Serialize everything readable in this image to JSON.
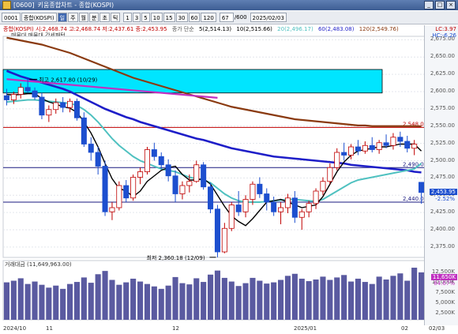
{
  "window": {
    "code": "[0600]",
    "title": "키움종합차트 - 종합(KOSPI)"
  },
  "toolbar": {
    "index_code": "0001",
    "index_name": "종합(KOSPI)",
    "period_buttons": [
      "일",
      "주",
      "월",
      "분",
      "초",
      "틱"
    ],
    "selected_period": "일",
    "interval_buttons": [
      "1",
      "3",
      "5",
      "10",
      "15",
      "30",
      "60",
      "120"
    ],
    "count": "67",
    "total": "/600",
    "date": "2025/02/03"
  },
  "legend": {
    "price_line": "종합(KOSPI) 시:2,468.74 고:2,468.74 저:2,437.61 종:2,453.95",
    "ma_label": "종가 단순",
    "ma5": "5(2,514.13)",
    "ma10": "10(2,515.66)",
    "ma20": "20(2,496.17)",
    "ma60": "60(2,483.08)",
    "ma120": "120(2,549.76)",
    "sub_label": "매물대 매물대 강세패턴",
    "lc": "LC:3.97",
    "hc": "HC:-6.26"
  },
  "annotations": {
    "high": "최고 2,617.80 (10/29)",
    "low": "최저 2,360.18 (12/09)"
  },
  "hlines": [
    {
      "value": 2548.08,
      "label": "2,548.08",
      "color": "#c00000"
    },
    {
      "value": 2490.0,
      "label": "2,490.00",
      "color": "#1a1a80"
    },
    {
      "value": 2440.0,
      "label": "2,440.00",
      "color": "#1a1a80"
    }
  ],
  "current": {
    "price": "2,453.95",
    "change": "-2.52%"
  },
  "price_axis": [
    "2,675.00",
    "2,650.00",
    "2,625.00",
    "2,600.00",
    "2,575.00",
    "2,550.00",
    "2,525.00",
    "2,500.00",
    "2,475.00",
    "2,450.00",
    "2,425.00",
    "2,400.00",
    "2,375.00"
  ],
  "volume": {
    "title": "거래대금 (11,649,963.00)",
    "current": "11,650K",
    "ratio": "84.67%",
    "axis": [
      "12,500K",
      "10,000K",
      "7,500K",
      "5,000K",
      "2,500K"
    ]
  },
  "xaxis": [
    "2024/10",
    "11",
    "12",
    "2025/01",
    "02",
    "02/03"
  ],
  "colors": {
    "up": "#c00000",
    "down": "#1d4fcf",
    "ma5": "#000000",
    "ma20": "#4fc1c0",
    "ma60": "#1e1ec8",
    "ma120": "#8a3a10",
    "box": "#00e5ff",
    "bar": "#5a5aa0"
  },
  "chart_data": {
    "type": "candlestick",
    "ylim": [
      2360,
      2680
    ],
    "candles": [
      [
        2594,
        2604,
        2580,
        2588
      ],
      [
        2588,
        2600,
        2582,
        2596
      ],
      [
        2596,
        2612,
        2590,
        2606
      ],
      [
        2606,
        2617.8,
        2598,
        2601
      ],
      [
        2601,
        2606,
        2588,
        2592
      ],
      [
        2592,
        2598,
        2560,
        2566
      ],
      [
        2566,
        2580,
        2556,
        2574
      ],
      [
        2574,
        2590,
        2568,
        2584
      ],
      [
        2584,
        2592,
        2570,
        2577
      ],
      [
        2577,
        2590,
        2570,
        2586
      ],
      [
        2586,
        2590,
        2558,
        2562
      ],
      [
        2562,
        2570,
        2520,
        2524
      ],
      [
        2524,
        2534,
        2500,
        2512
      ],
      [
        2512,
        2520,
        2480,
        2492
      ],
      [
        2492,
        2500,
        2420,
        2426
      ],
      [
        2426,
        2440,
        2414,
        2432
      ],
      [
        2432,
        2470,
        2428,
        2464
      ],
      [
        2464,
        2472,
        2440,
        2446
      ],
      [
        2446,
        2480,
        2442,
        2476
      ],
      [
        2476,
        2490,
        2466,
        2484
      ],
      [
        2484,
        2520,
        2480,
        2516
      ],
      [
        2516,
        2526,
        2500,
        2506
      ],
      [
        2506,
        2512,
        2488,
        2494
      ],
      [
        2494,
        2502,
        2470,
        2478
      ],
      [
        2478,
        2486,
        2440,
        2452
      ],
      [
        2452,
        2470,
        2444,
        2464
      ],
      [
        2464,
        2480,
        2454,
        2470
      ],
      [
        2470,
        2500,
        2468,
        2494
      ],
      [
        2494,
        2498,
        2458,
        2462
      ],
      [
        2462,
        2468,
        2424,
        2430
      ],
      [
        2430,
        2436,
        2360.18,
        2368
      ],
      [
        2368,
        2410,
        2366,
        2402
      ],
      [
        2402,
        2440,
        2398,
        2436
      ],
      [
        2436,
        2456,
        2420,
        2426
      ],
      [
        2426,
        2450,
        2418,
        2444
      ],
      [
        2444,
        2470,
        2436,
        2466
      ],
      [
        2466,
        2476,
        2446,
        2452
      ],
      [
        2452,
        2460,
        2428,
        2440
      ],
      [
        2440,
        2448,
        2420,
        2426
      ],
      [
        2426,
        2440,
        2408,
        2432
      ],
      [
        2432,
        2452,
        2424,
        2446
      ],
      [
        2446,
        2456,
        2410,
        2418
      ],
      [
        2418,
        2430,
        2400,
        2426
      ],
      [
        2426,
        2442,
        2418,
        2438
      ],
      [
        2438,
        2460,
        2430,
        2456
      ],
      [
        2456,
        2476,
        2450,
        2470
      ],
      [
        2470,
        2496,
        2466,
        2490
      ],
      [
        2490,
        2518,
        2486,
        2512
      ],
      [
        2512,
        2526,
        2500,
        2508
      ],
      [
        2508,
        2524,
        2502,
        2520
      ],
      [
        2520,
        2530,
        2508,
        2514
      ],
      [
        2514,
        2528,
        2510,
        2522
      ],
      [
        2522,
        2534,
        2512,
        2516
      ],
      [
        2516,
        2530,
        2510,
        2526
      ],
      [
        2526,
        2538,
        2518,
        2522
      ],
      [
        2522,
        2540,
        2516,
        2534
      ],
      [
        2534,
        2542,
        2520,
        2528
      ],
      [
        2528,
        2536,
        2512,
        2518
      ],
      [
        2518,
        2530,
        2508,
        2524
      ],
      [
        2468.74,
        2468.74,
        2437.61,
        2453.95
      ]
    ],
    "ma5": [
      2596,
      2595,
      2596,
      2597,
      2597,
      2590,
      2585,
      2582,
      2578,
      2576,
      2570,
      2556,
      2540,
      2520,
      2496,
      2474,
      2460,
      2456,
      2448,
      2456,
      2470,
      2478,
      2486,
      2490,
      2492,
      2480,
      2472,
      2472,
      2474,
      2466,
      2450,
      2434,
      2420,
      2412,
      2406,
      2416,
      2428,
      2440,
      2442,
      2444,
      2440,
      2436,
      2432,
      2434,
      2436,
      2448,
      2466,
      2484,
      2498,
      2508,
      2514,
      2516,
      2518,
      2520,
      2520,
      2522,
      2524,
      2524,
      2524,
      2514
    ],
    "ma20": [
      2585,
      2586,
      2587,
      2588,
      2588,
      2587,
      2586,
      2585,
      2584,
      2583,
      2580,
      2574,
      2566,
      2556,
      2544,
      2532,
      2522,
      2514,
      2506,
      2500,
      2496,
      2492,
      2488,
      2486,
      2484,
      2480,
      2476,
      2474,
      2472,
      2468,
      2460,
      2452,
      2446,
      2442,
      2440,
      2440,
      2440,
      2441,
      2442,
      2443,
      2444,
      2444,
      2443,
      2442,
      2441,
      2444,
      2450,
      2456,
      2462,
      2468,
      2472,
      2474,
      2476,
      2478,
      2480,
      2482,
      2484,
      2486,
      2488,
      2496
    ],
    "ma60": [
      2630,
      2626,
      2622,
      2619,
      2616,
      2613,
      2610,
      2607,
      2604,
      2600,
      2595,
      2590,
      2585,
      2580,
      2575,
      2571,
      2567,
      2563,
      2560,
      2556,
      2553,
      2550,
      2547,
      2544,
      2541,
      2538,
      2535,
      2532,
      2530,
      2527,
      2524,
      2521,
      2518,
      2516,
      2514,
      2512,
      2510,
      2508,
      2506,
      2505,
      2504,
      2503,
      2502,
      2501,
      2500,
      2499,
      2498,
      2497,
      2496,
      2494,
      2493,
      2492,
      2491,
      2490,
      2489,
      2488,
      2487,
      2486,
      2484,
      2483
    ],
    "ma120": [
      2678,
      2676,
      2674,
      2672,
      2670,
      2668,
      2665,
      2662,
      2659,
      2656,
      2652,
      2648,
      2644,
      2640,
      2636,
      2632,
      2628,
      2624,
      2620,
      2617,
      2614,
      2611,
      2608,
      2605,
      2602,
      2599,
      2596,
      2593,
      2590,
      2587,
      2584,
      2581,
      2578,
      2576,
      2574,
      2572,
      2570,
      2568,
      2566,
      2564,
      2562,
      2560,
      2559,
      2558,
      2557,
      2556,
      2555,
      2554,
      2553,
      2552,
      2551,
      2551,
      2550,
      2550,
      2550,
      2550,
      2550,
      2550,
      2550,
      2549.76
    ],
    "volume": [
      9.2,
      9.6,
      10.2,
      8.8,
      9.4,
      8.6,
      7.9,
      8.4,
      7.6,
      8.8,
      9.3,
      10.4,
      9.1,
      11.2,
      12.0,
      9.8,
      8.6,
      9.2,
      10.1,
      9.4,
      8.8,
      8.2,
      7.6,
      8.4,
      10.5,
      9.0,
      8.7,
      10.2,
      9.3,
      11.1,
      12.1,
      10.3,
      9.4,
      8.3,
      9.0,
      10.3,
      9.6,
      8.9,
      9.2,
      9.8,
      10.8,
      11.3,
      10.1,
      9.5,
      9.9,
      10.6,
      9.8,
      10.4,
      11.0,
      9.4,
      10.1,
      9.3,
      8.8,
      10.6,
      9.9,
      10.8,
      11.4,
      9.6,
      12.8,
      11.65
    ]
  }
}
